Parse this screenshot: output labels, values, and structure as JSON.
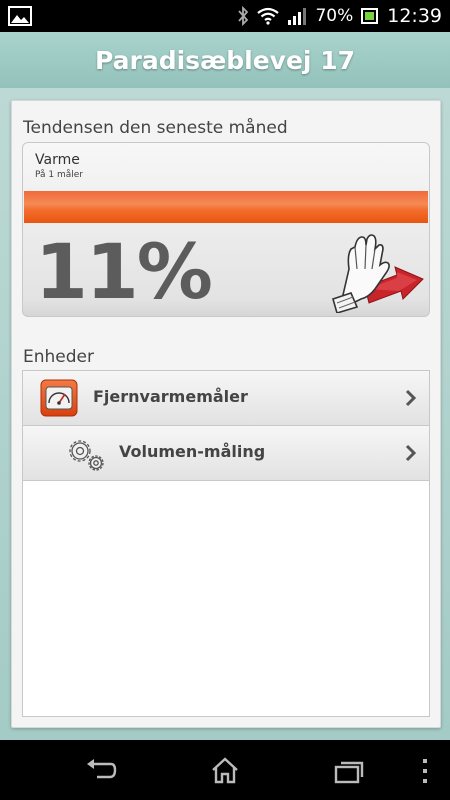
{
  "status_bar": {
    "battery_percent": "70%",
    "time": "12:39",
    "icons": [
      "gallery-icon",
      "bluetooth-icon",
      "wifi-icon",
      "signal-icon",
      "battery-icon"
    ]
  },
  "header": {
    "title": "Paradisæblevej 17"
  },
  "trend": {
    "section_label": "Tendensen den seneste måned",
    "name": "Varme",
    "subtitle": "På 1 måler",
    "value": "11%",
    "bar_color": "#f06a2f",
    "icon": "hand-arrow-icon"
  },
  "units": {
    "section_label": "Enheder",
    "items": [
      {
        "label": "Fjernvarmemåler",
        "icon": "meter-icon"
      },
      {
        "label": "Volumen-måling",
        "icon": "gears-icon"
      }
    ]
  },
  "nav": {
    "icons": [
      "back-icon",
      "home-icon",
      "recents-icon",
      "menu-icon"
    ]
  },
  "colors": {
    "header": "#9fc7c1",
    "accent": "#f06a2f"
  }
}
